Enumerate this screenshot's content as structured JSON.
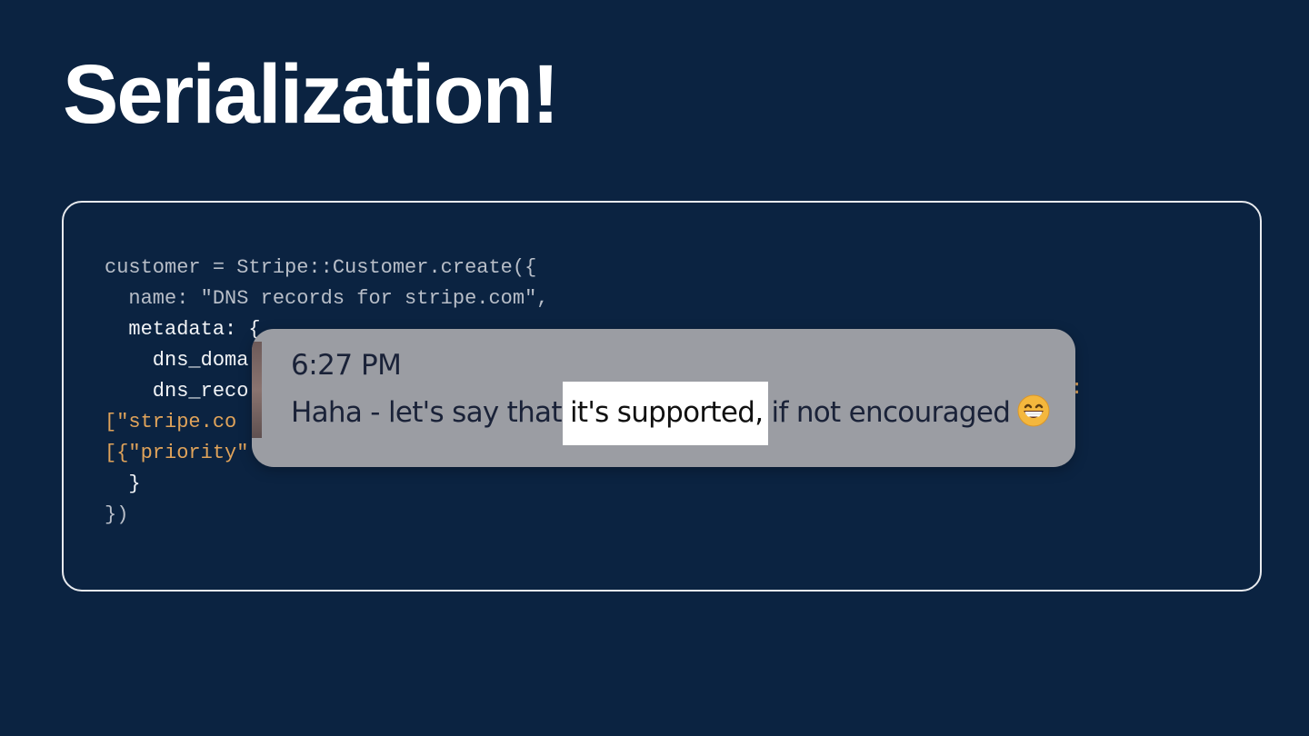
{
  "slide": {
    "title": "Serialization!"
  },
  "code": {
    "lines": [
      "customer = Stripe::Customer.create({",
      "  name: \"DNS records for stripe.com\",",
      "  metadata: {",
      "    dns_doma",
      "    dns_reco",
      "[\"stripe.co",
      "[{\"priority\"",
      "  }",
      "})"
    ],
    "orange_tail": ":"
  },
  "chat": {
    "time": "6:27 PM",
    "message_before": "Haha - let's say that ",
    "message_highlight": "it's supported,",
    "message_after": " if not encouraged",
    "emoji": "grinning-face-icon"
  },
  "colors": {
    "background": "#0b2341",
    "code_text": "#b8bec8",
    "code_string_accent": "#e0a35a",
    "highlight": "#ffffff"
  }
}
